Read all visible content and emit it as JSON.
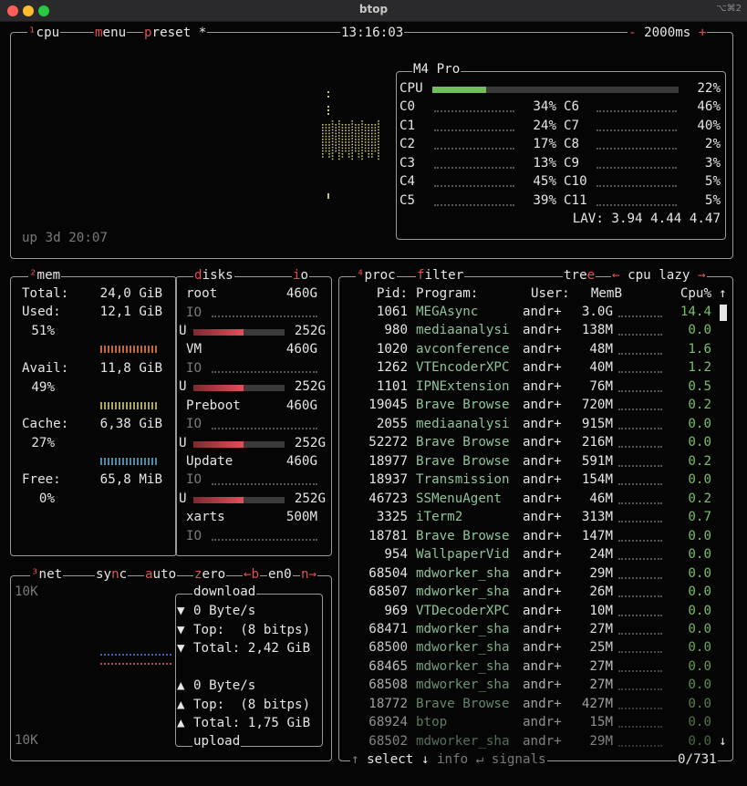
{
  "window": {
    "title": "btop",
    "shortcut": "⌥⌘2"
  },
  "cpu_panel": {
    "menu_items": [
      "¹cpu",
      "menu",
      "preset *"
    ],
    "clock": "13:16:03",
    "interval": {
      "minus": "-",
      "value": "2000ms",
      "plus": "+"
    },
    "uptime": "up 3d 20:07",
    "model": "M4 Pro",
    "total_label": "CPU",
    "total_percent": "22%",
    "total_fraction": 0.22,
    "cores_left": [
      {
        "name": "C0",
        "pct": "34%"
      },
      {
        "name": "C1",
        "pct": "24%"
      },
      {
        "name": "C2",
        "pct": "17%"
      },
      {
        "name": "C3",
        "pct": "13%"
      },
      {
        "name": "C4",
        "pct": "45%"
      },
      {
        "name": "C5",
        "pct": "39%"
      }
    ],
    "cores_right": [
      {
        "name": "C6",
        "pct": "46%"
      },
      {
        "name": "C7",
        "pct": "40%"
      },
      {
        "name": "C8",
        "pct": "2%"
      },
      {
        "name": "C9",
        "pct": "3%"
      },
      {
        "name": "C10",
        "pct": "5%"
      },
      {
        "name": "C11",
        "pct": "5%"
      }
    ],
    "load_avg": "LAV: 3.94 4.44 4.47"
  },
  "mem_panel": {
    "title": "²mem",
    "rows": [
      {
        "label": "Total:",
        "value": "24,0 GiB",
        "pct": ""
      },
      {
        "label": "Used:",
        "value": "12,1 GiB",
        "pct": "51%"
      },
      {
        "label": "Avail:",
        "value": "11,8 GiB",
        "pct": "49%"
      },
      {
        "label": "Cache:",
        "value": "6,38 GiB",
        "pct": "27%"
      },
      {
        "label": "Free:",
        "value": "65,8 MiB",
        "pct": "0%"
      }
    ]
  },
  "disks_panel": {
    "title": "disks",
    "io_tab": "io",
    "disks": [
      {
        "name": "root",
        "size": "460G",
        "io": "IO",
        "used_label": "U",
        "used": "252G",
        "fraction": 0.55
      },
      {
        "name": "VM",
        "size": "460G",
        "io": "IO",
        "used_label": "U",
        "used": "252G",
        "fraction": 0.55
      },
      {
        "name": "Preboot",
        "size": "460G",
        "io": "IO",
        "used_label": "U",
        "used": "252G",
        "fraction": 0.55
      },
      {
        "name": "Update",
        "size": "460G",
        "io": "IO",
        "used_label": "U",
        "used": "252G",
        "fraction": 0.55
      },
      {
        "name": "xarts",
        "size": "500M",
        "io": "IO"
      }
    ]
  },
  "net_panel": {
    "tabs": [
      "³net",
      "sync",
      "auto",
      "zero",
      "←b",
      "en0",
      "n→"
    ],
    "scale_top": "10K",
    "scale_bottom": "10K",
    "download_title": "download",
    "upload_title": "upload",
    "download": [
      {
        "arrow": "▼",
        "text": "0 Byte/s"
      },
      {
        "arrow": "▼",
        "text": "Top:  (8 bitps)"
      },
      {
        "arrow": "▼",
        "text": "Total: 2,42 GiB"
      }
    ],
    "upload": [
      {
        "arrow": "▲",
        "text": "0 Byte/s"
      },
      {
        "arrow": "▲",
        "text": "Top:  (8 bitps)"
      },
      {
        "arrow": "▲",
        "text": "Total: 1,75 GiB"
      }
    ]
  },
  "proc_panel": {
    "tabs": [
      "⁴proc",
      "filter",
      "tree",
      "← cpu lazy →"
    ],
    "columns": {
      "pid": "Pid:",
      "program": "Program:",
      "user": "User:",
      "mem": "MemB",
      "cpu": "Cpu%"
    },
    "scroll_up": "↑",
    "scroll_down": "↓",
    "rows": [
      {
        "pid": "1061",
        "program": "MEGAsync",
        "user": "andr+",
        "mem": "3.0G",
        "cpu": "14.4"
      },
      {
        "pid": "980",
        "program": "mediaanalysi",
        "user": "andr+",
        "mem": "138M",
        "cpu": "0.0"
      },
      {
        "pid": "1020",
        "program": "avconference",
        "user": "andr+",
        "mem": "48M",
        "cpu": "1.6"
      },
      {
        "pid": "1262",
        "program": "VTEncoderXPC",
        "user": "andr+",
        "mem": "40M",
        "cpu": "1.2"
      },
      {
        "pid": "1101",
        "program": "IPNExtension",
        "user": "andr+",
        "mem": "76M",
        "cpu": "0.5"
      },
      {
        "pid": "19045",
        "program": "Brave Browse",
        "user": "andr+",
        "mem": "720M",
        "cpu": "0.2"
      },
      {
        "pid": "2055",
        "program": "mediaanalysi",
        "user": "andr+",
        "mem": "915M",
        "cpu": "0.0"
      },
      {
        "pid": "52272",
        "program": "Brave Browse",
        "user": "andr+",
        "mem": "216M",
        "cpu": "0.0"
      },
      {
        "pid": "18977",
        "program": "Brave Browse",
        "user": "andr+",
        "mem": "591M",
        "cpu": "0.2"
      },
      {
        "pid": "18937",
        "program": "Transmission",
        "user": "andr+",
        "mem": "154M",
        "cpu": "0.0"
      },
      {
        "pid": "46723",
        "program": "SSMenuAgent",
        "user": "andr+",
        "mem": "46M",
        "cpu": "0.2"
      },
      {
        "pid": "3325",
        "program": "iTerm2",
        "user": "andr+",
        "mem": "313M",
        "cpu": "0.7"
      },
      {
        "pid": "18781",
        "program": "Brave Browse",
        "user": "andr+",
        "mem": "147M",
        "cpu": "0.0"
      },
      {
        "pid": "954",
        "program": "WallpaperVid",
        "user": "andr+",
        "mem": "24M",
        "cpu": "0.0"
      },
      {
        "pid": "68504",
        "program": "mdworker_sha",
        "user": "andr+",
        "mem": "29M",
        "cpu": "0.0"
      },
      {
        "pid": "68507",
        "program": "mdworker_sha",
        "user": "andr+",
        "mem": "26M",
        "cpu": "0.0"
      },
      {
        "pid": "969",
        "program": "VTDecoderXPC",
        "user": "andr+",
        "mem": "10M",
        "cpu": "0.0"
      },
      {
        "pid": "68471",
        "program": "mdworker_sha",
        "user": "andr+",
        "mem": "27M",
        "cpu": "0.0"
      },
      {
        "pid": "68500",
        "program": "mdworker_sha",
        "user": "andr+",
        "mem": "25M",
        "cpu": "0.0"
      },
      {
        "pid": "68465",
        "program": "mdworker_sha",
        "user": "andr+",
        "mem": "27M",
        "cpu": "0.0"
      },
      {
        "pid": "68508",
        "program": "mdworker_sha",
        "user": "andr+",
        "mem": "27M",
        "cpu": "0.0"
      },
      {
        "pid": "18772",
        "program": "Brave Browse",
        "user": "andr+",
        "mem": "427M",
        "cpu": "0.0"
      },
      {
        "pid": "68924",
        "program": "btop",
        "user": "andr+",
        "mem": "15M",
        "cpu": "0.0"
      },
      {
        "pid": "68502",
        "program": "mdworker_sha",
        "user": "andr+",
        "mem": "29M",
        "cpu": "0.0"
      }
    ],
    "footer": {
      "select": "select ↓",
      "info": "info ↵",
      "signals": "signals",
      "count": "0/731"
    }
  },
  "colors": {
    "accent_red": "#e05050",
    "green": "#7bbf6a",
    "border": "#9a9a9a"
  }
}
